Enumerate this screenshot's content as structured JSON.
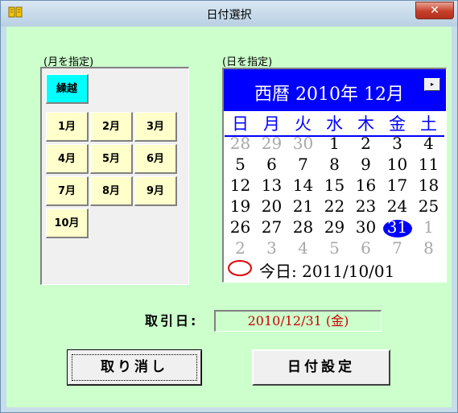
{
  "window": {
    "title": "日付選択",
    "close_glyph": "✕",
    "icon": "book-icon"
  },
  "month_group": {
    "label": "(月を指定)",
    "carry_over_label": "繰越",
    "months": [
      "1月",
      "2月",
      "3月",
      "4月",
      "5月",
      "6月",
      "7月",
      "8月",
      "9月",
      "10月"
    ]
  },
  "day_group": {
    "label": "(日を指定)"
  },
  "calendar": {
    "header_title": "西暦 2010年 12月",
    "next_glyph": "▸",
    "weekdays": [
      "日",
      "月",
      "火",
      "水",
      "木",
      "金",
      "土"
    ],
    "weeks": [
      [
        "28",
        "29",
        "30",
        "1",
        "2",
        "3",
        "4"
      ],
      [
        "5",
        "6",
        "7",
        "8",
        "9",
        "10",
        "11"
      ],
      [
        "12",
        "13",
        "14",
        "15",
        "16",
        "17",
        "18"
      ],
      [
        "19",
        "20",
        "21",
        "22",
        "23",
        "24",
        "25"
      ],
      [
        "26",
        "27",
        "28",
        "29",
        "30",
        "31",
        "1"
      ],
      [
        "2",
        "3",
        "4",
        "5",
        "6",
        "7",
        "8"
      ]
    ],
    "selected_day": "31",
    "today_text": "今日: 2011/10/01",
    "colors": {
      "header_bg": "#0000ff",
      "weekday": "#0000ff",
      "other_month": "#a8a8a8",
      "today_circle": "#e00000"
    }
  },
  "trade_date": {
    "label": "取引日:",
    "value": "2010/12/31 (金)",
    "color": "#cc0000"
  },
  "buttons": {
    "cancel": "取り消し",
    "set_date": "日付設定"
  },
  "colors": {
    "client_bg": "#ccffcc",
    "month_button": "#ffffcc",
    "carry_button": "#00ffff"
  }
}
